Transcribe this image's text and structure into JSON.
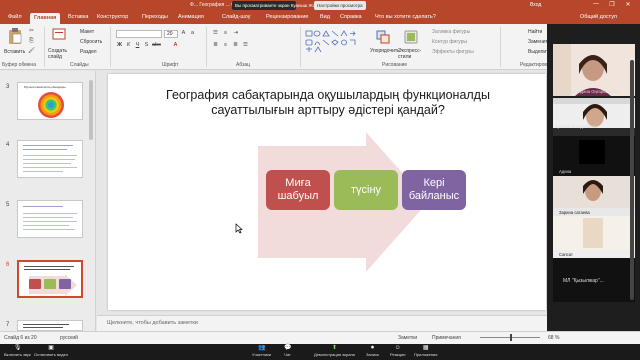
{
  "titlebar": {
    "title": "Ф... География ... Сохранено",
    "share_notice": "Вы просматриваете экран Куаныш Жолдыбаева",
    "presenter_btn": "Настройки просмотра",
    "user": "Вход",
    "controls": [
      "—",
      "❐",
      "✕"
    ]
  },
  "tabs": [
    "Файл",
    "Главная",
    "Вставка",
    "Конструктор",
    "Переходы",
    "Анимация",
    "Слайд-шоу",
    "Рецензирование",
    "Вид",
    "Справка",
    "Что вы хотите сделать?",
    "Общий доступ"
  ],
  "ribbon": {
    "paste_label": "Вставить",
    "create_label": "Создать слайд",
    "layout_label": "Макет",
    "reset_label": "Сбросить",
    "section_label": "Раздел",
    "font_size": "20",
    "arrange_label": "Упорядочить",
    "quick_styles_label": "Экспресс-стили",
    "fill_label": "Заливка фигуры",
    "outline_label": "Контур фигуры",
    "effects_label": "Эффекты фигуры",
    "find_label": "Найти",
    "replace_label": "Заменить",
    "select_label": "Выделить",
    "groups": [
      "Буфер обмена",
      "Слайды",
      "Шрифт",
      "Абзац",
      "Рисование",
      "Редактирование"
    ]
  },
  "thumbnails": {
    "numbers": [
      "3",
      "4",
      "5",
      "6",
      "7"
    ],
    "slide3_title": "Мультипликативтің ойындары",
    "slide6_boxes": [
      "Миға шабуыл",
      "түсіну",
      "Кері байланыс"
    ]
  },
  "slide": {
    "title": "География сабақтарында оқушылардың функционалды сауаттылығын арттыру әдістері қандай?",
    "boxes": [
      {
        "label": "Миға шабуыл",
        "color": "#c0504d"
      },
      {
        "label": "түсіну",
        "color": "#9bbb59"
      },
      {
        "label": "Кері байланыс",
        "color": "#8064a2"
      }
    ],
    "arrow_color": "#f2dcdb"
  },
  "notes_placeholder": "Щелкните, чтобы добавить заметки",
  "participants": [
    {
      "name": "Жанаева Гүлдана Оңғарбеккызы"
    },
    {
      "name": "Куаныш Жолдыбаева"
    },
    {
      "name": "Адина"
    },
    {
      "name": "Зарина сатаева"
    },
    {
      "name": "Сапсат"
    },
    {
      "name": "МЛ \"Қызылжар\"..."
    }
  ],
  "status": {
    "slide_info": "Слайд 6 из 20",
    "language": "русский",
    "notes_btn": "Заметки",
    "comments_btn": "Примечания",
    "zoom": "68 %"
  },
  "meeting_toolbar": {
    "left": [
      "Включить звук",
      "Остановить видео"
    ],
    "center": [
      "Участники",
      "Чат",
      "Демонстрация экрана",
      "Запись",
      "Реакции",
      "Приложения"
    ]
  },
  "colors": {
    "accent": "#b7472a"
  }
}
